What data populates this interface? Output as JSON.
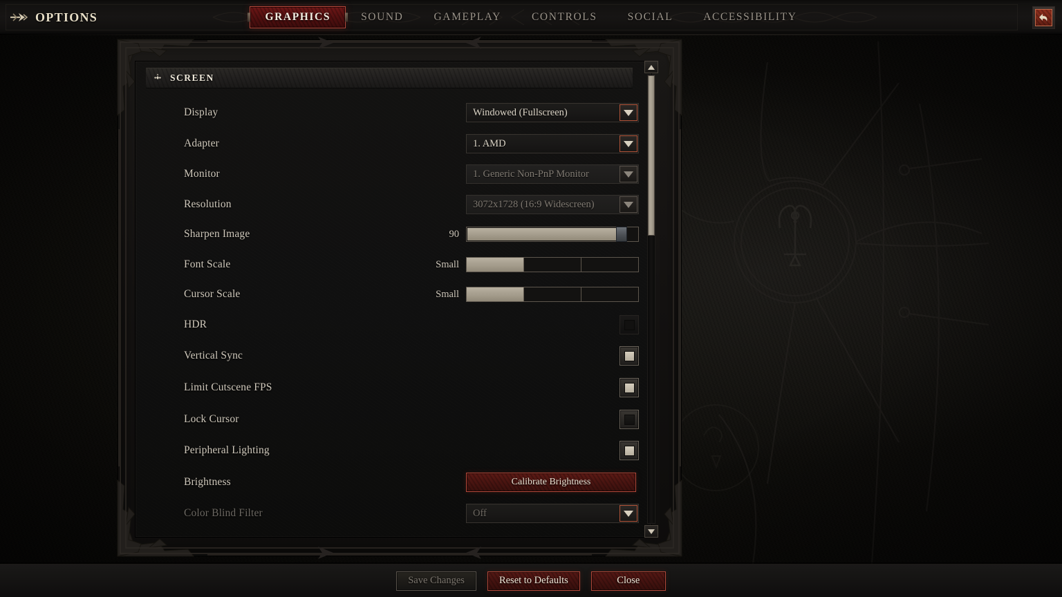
{
  "header": {
    "title": "OPTIONS",
    "arrow_icon": "arrow-right-icon",
    "back_icon": "back-arrow-icon",
    "tabs": [
      {
        "label": "GRAPHICS",
        "active": true
      },
      {
        "label": "SOUND",
        "active": false
      },
      {
        "label": "GAMEPLAY",
        "active": false
      },
      {
        "label": "CONTROLS",
        "active": false
      },
      {
        "label": "SOCIAL",
        "active": false
      },
      {
        "label": "ACCESSIBILITY",
        "active": false
      }
    ]
  },
  "panel": {
    "section_icon": "diamond-cluster-icon",
    "section_title": "SCREEN",
    "rows": [
      {
        "label": "Display",
        "type": "dropdown",
        "value": "Windowed (Fullscreen)",
        "enabled": true
      },
      {
        "label": "Adapter",
        "type": "dropdown",
        "value": "1. AMD",
        "enabled": true
      },
      {
        "label": "Monitor",
        "type": "dropdown",
        "value": "1. Generic Non-PnP Monitor",
        "enabled": false
      },
      {
        "label": "Resolution",
        "type": "dropdown",
        "value": "3072x1728 (16:9 Widescreen)",
        "enabled": false
      },
      {
        "label": "Sharpen Image",
        "type": "slider",
        "value": "90",
        "percent": 90,
        "enabled": true
      },
      {
        "label": "Font Scale",
        "type": "stepper",
        "value": "Small",
        "steps": 3,
        "selected": 1,
        "enabled": true
      },
      {
        "label": "Cursor Scale",
        "type": "stepper",
        "value": "Small",
        "steps": 3,
        "selected": 1,
        "enabled": true
      },
      {
        "label": "HDR",
        "type": "checkbox",
        "checked": false,
        "enabled": false
      },
      {
        "label": "Vertical Sync",
        "type": "checkbox",
        "checked": true,
        "enabled": true
      },
      {
        "label": "Limit Cutscene FPS",
        "type": "checkbox",
        "checked": true,
        "enabled": true
      },
      {
        "label": "Lock Cursor",
        "type": "checkbox",
        "checked": false,
        "enabled": true
      },
      {
        "label": "Peripheral Lighting",
        "type": "checkbox",
        "checked": true,
        "enabled": true
      },
      {
        "label": "Brightness",
        "type": "button",
        "value": "Calibrate Brightness",
        "enabled": true
      },
      {
        "label": "Color Blind Filter",
        "type": "dropdown",
        "value": "Off",
        "enabled": true,
        "label_dim": true
      }
    ]
  },
  "scrollbar": {
    "up_icon": "triangle-up-icon",
    "down_icon": "triangle-down-icon",
    "thumb_position_percent": 0,
    "thumb_size_percent": 36
  },
  "footer": {
    "buttons": [
      {
        "label": "Save Changes",
        "style": "disabled"
      },
      {
        "label": "Reset to Defaults",
        "style": "red"
      },
      {
        "label": "Close",
        "style": "red"
      }
    ]
  },
  "colors": {
    "accent_red": "#b3483a",
    "tab_active_bg": "#5b1212",
    "text_primary": "#cfc8bb",
    "text_bright": "#efe9db",
    "text_dim": "#6b6761",
    "slider_fill": "#a49c8c"
  }
}
